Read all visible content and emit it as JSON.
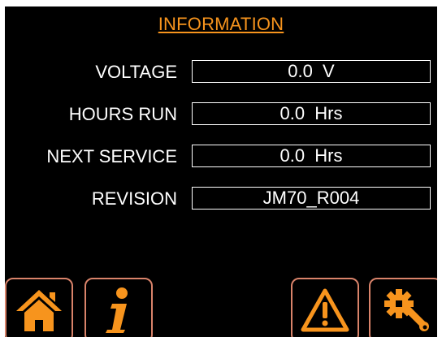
{
  "title": "INFORMATION",
  "rows": [
    {
      "label": "VOLTAGE",
      "value": "0.0  V"
    },
    {
      "label": "HOURS RUN",
      "value": "0.0  Hrs"
    },
    {
      "label": "NEXT SERVICE",
      "value": "0.0  Hrs"
    },
    {
      "label": "REVISION",
      "value": "JM70_R004"
    }
  ],
  "nav": {
    "home_icon": "home-icon",
    "info_icon": "info-icon",
    "warning_icon": "warning-icon",
    "settings_icon": "wrench-gear-icon"
  },
  "colors": {
    "accent": "#f7941d",
    "button_border": "#d9836a",
    "background": "#000000",
    "text": "#ffffff"
  }
}
